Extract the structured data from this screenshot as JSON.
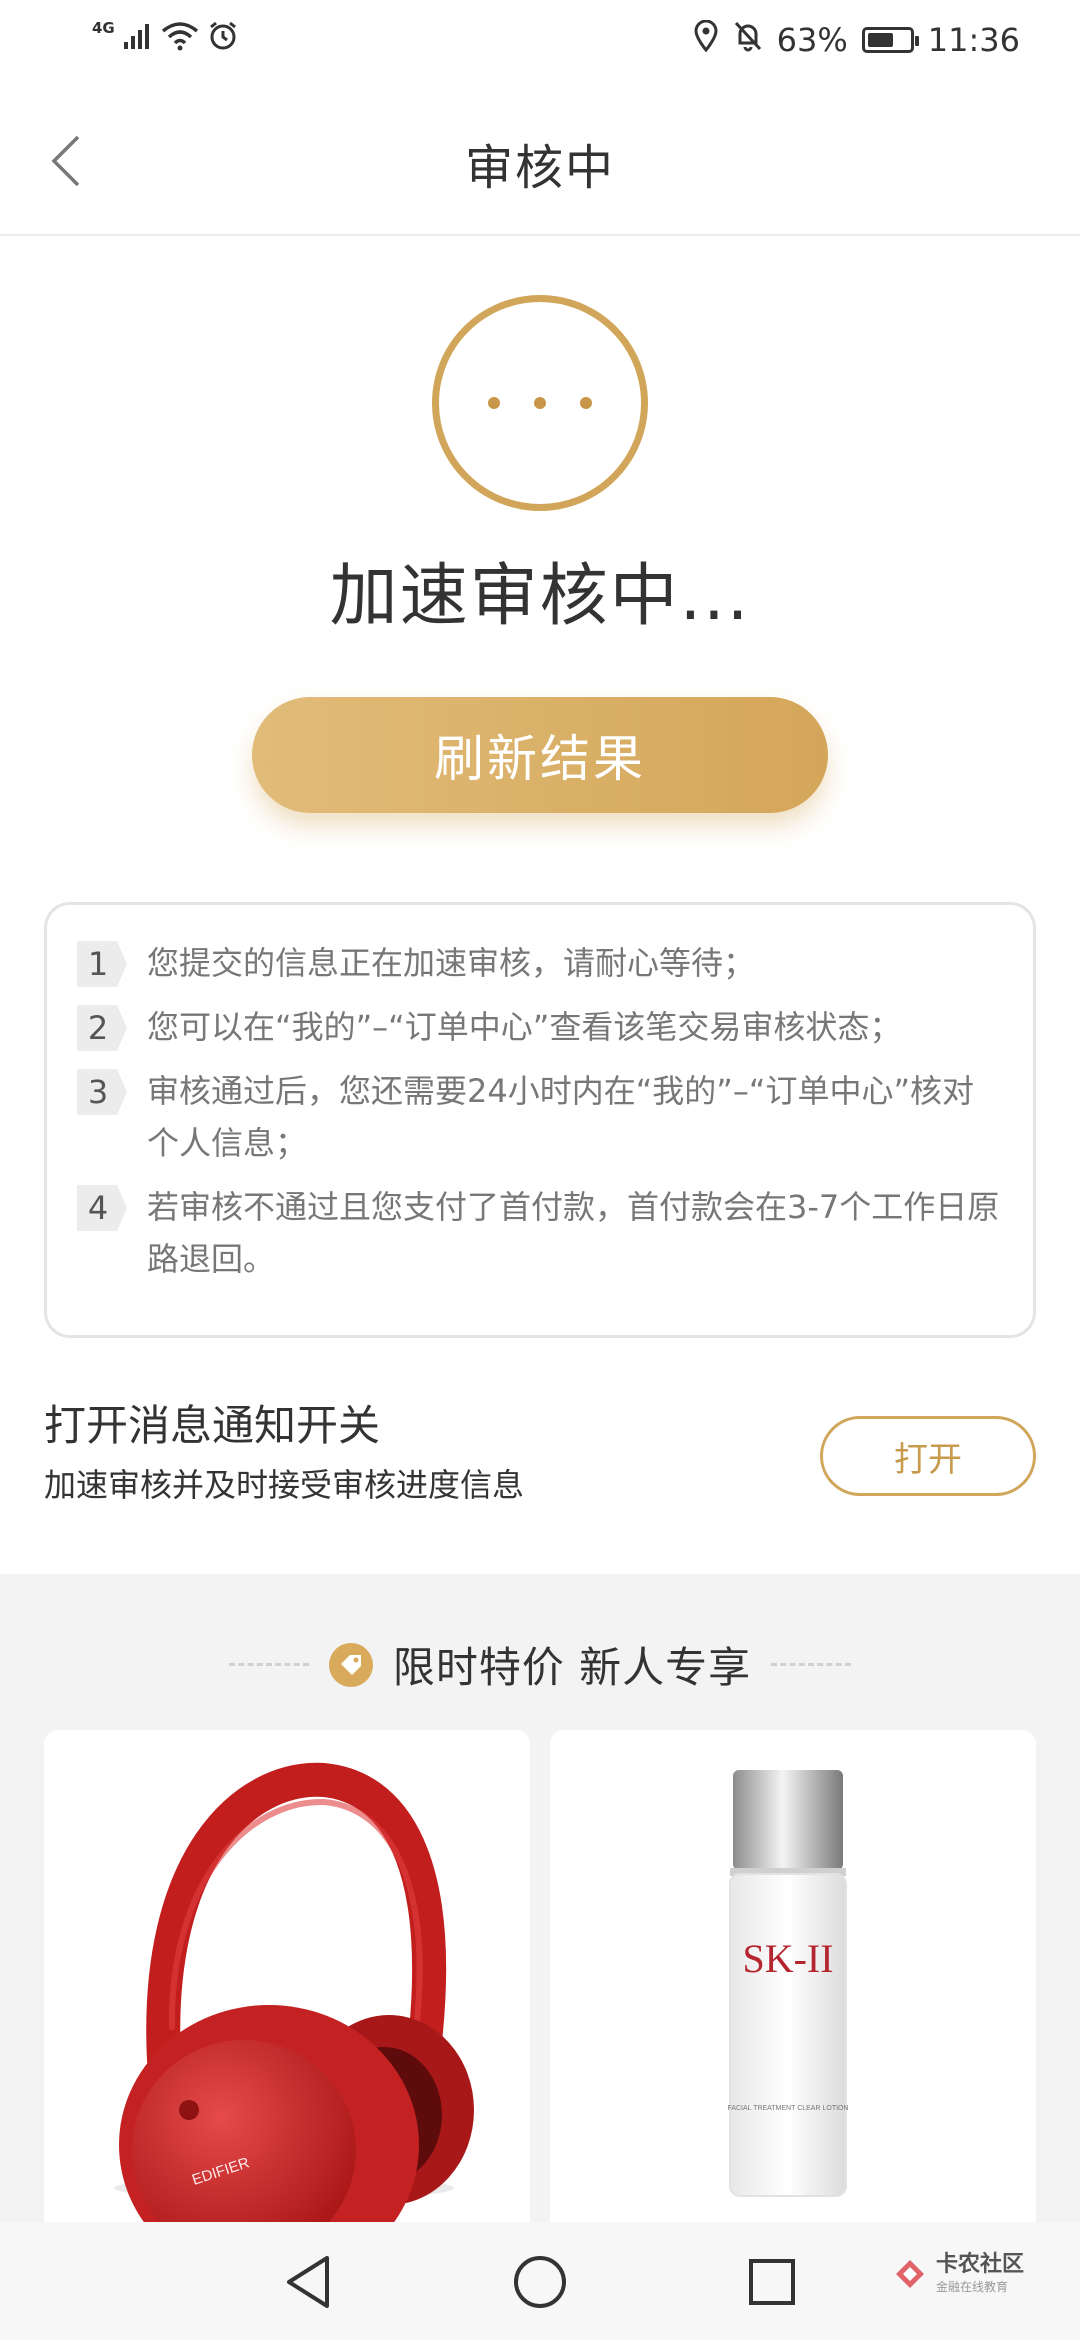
{
  "status_bar": {
    "network": "4G",
    "battery": "63%",
    "battery_level": 0.63,
    "time": "11:36"
  },
  "nav": {
    "title": "审核中"
  },
  "status": {
    "main_text": "加速审核中..."
  },
  "refresh_button": {
    "label": "刷新结果"
  },
  "info": {
    "items": [
      {
        "num": "1",
        "text": "您提交的信息正在加速审核，请耐心等待；"
      },
      {
        "num": "2",
        "text": "您可以在“我的”–“订单中心”查看该笔交易审核状态；"
      },
      {
        "num": "3",
        "text": "审核通过后，您还需要24小时内在“我的”–“订单中心”核对个人信息；"
      },
      {
        "num": "4",
        "text": "若审核不通过且您支付了首付款，首付款会在3-7个工作日原路退回。"
      }
    ]
  },
  "notification": {
    "title": "打开消息通知开关",
    "subtitle": "加速审核并及时接受审核进度信息",
    "button": "打开"
  },
  "promo": {
    "title": "限时特价 新人专享",
    "products": [
      {
        "image": "red-headphones",
        "brand_text": "EDIFIER"
      },
      {
        "image": "skincare-bottle",
        "brand_text": "SK-II",
        "label_text": "FACIAL TREATMENT CLEAR LOTION"
      }
    ]
  },
  "watermark": {
    "title": "卡农社区",
    "subtitle": "金融在线教育"
  },
  "colors": {
    "accent": "#d4a659",
    "accent_light": "#e1bc79",
    "text_main": "#333333",
    "text_muted": "#777777",
    "section_bg": "#f3f3f3"
  }
}
